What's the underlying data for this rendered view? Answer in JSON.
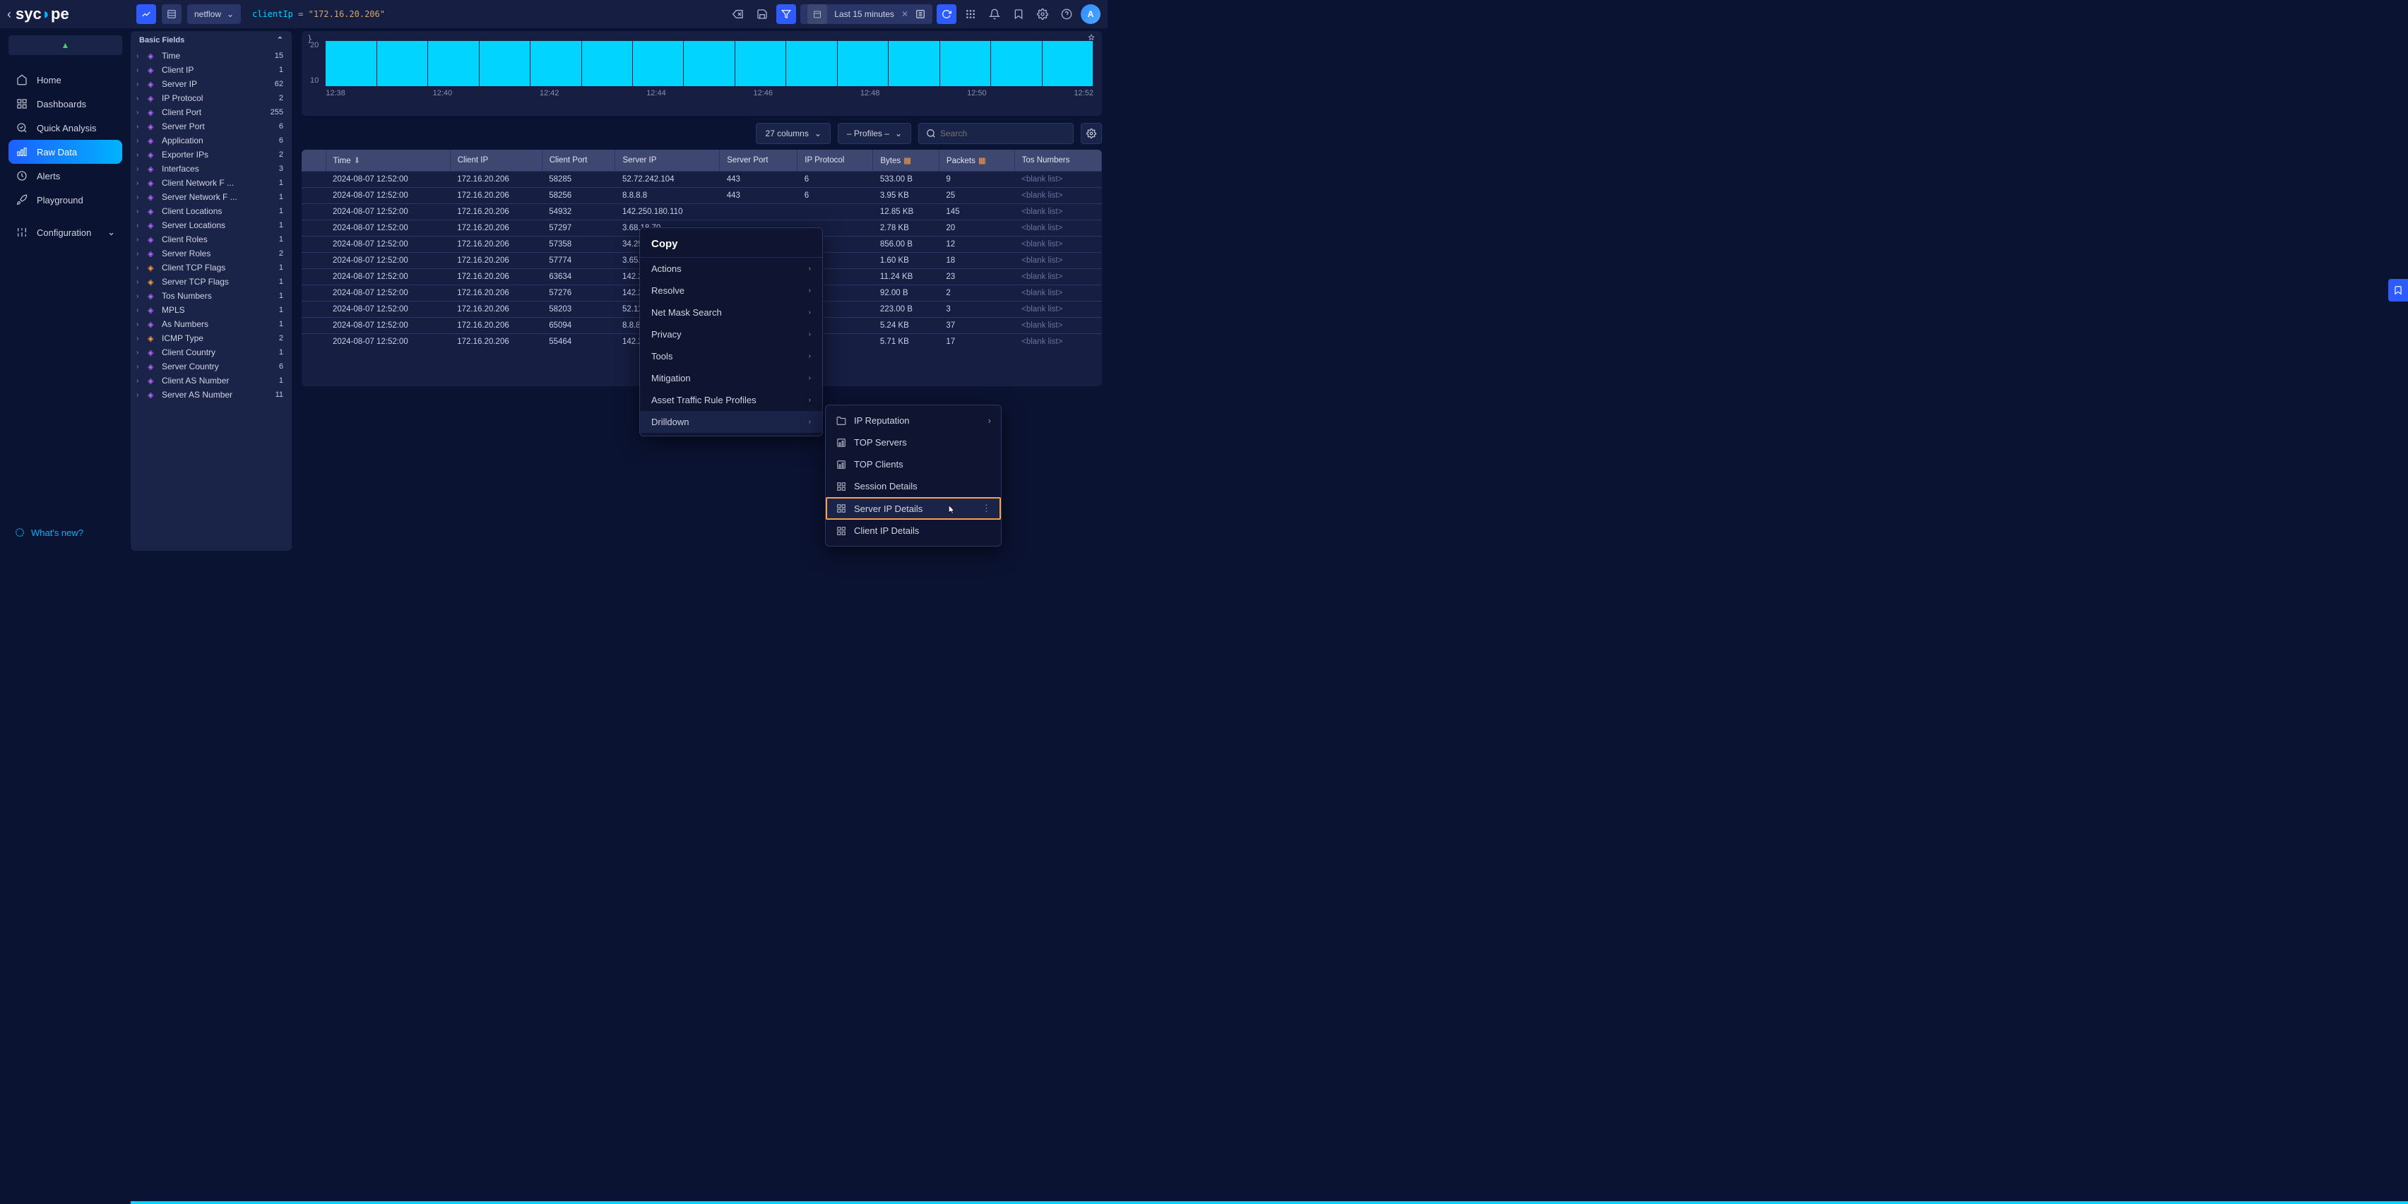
{
  "topbar": {
    "stream": "netflow",
    "query_key": "clientIp",
    "query_eq": "=",
    "query_val": "\"172.16.20.206\"",
    "timerange": "Last 15 minutes",
    "avatar": "A"
  },
  "nav": {
    "items": [
      {
        "label": "Home",
        "icon": "home"
      },
      {
        "label": "Dashboards",
        "icon": "grid"
      },
      {
        "label": "Quick Analysis",
        "icon": "magnify"
      },
      {
        "label": "Raw Data",
        "icon": "bars",
        "active": true
      },
      {
        "label": "Alerts",
        "icon": "bell"
      },
      {
        "label": "Playground",
        "icon": "rocket"
      }
    ],
    "config": "Configuration",
    "whatsnew": "What's new?"
  },
  "fields": {
    "header": "Basic Fields",
    "rows": [
      {
        "name": "Time",
        "count": "15",
        "cube": "p"
      },
      {
        "name": "Client IP",
        "count": "1",
        "cube": "p"
      },
      {
        "name": "Server IP",
        "count": "62",
        "cube": "p"
      },
      {
        "name": "IP Protocol",
        "count": "2",
        "cube": "p"
      },
      {
        "name": "Client Port",
        "count": "255",
        "cube": "p"
      },
      {
        "name": "Server Port",
        "count": "6",
        "cube": "p"
      },
      {
        "name": "Application",
        "count": "6",
        "cube": "p"
      },
      {
        "name": "Exporter IPs",
        "count": "2",
        "cube": "p"
      },
      {
        "name": "Interfaces",
        "count": "3",
        "cube": "p"
      },
      {
        "name": "Client Network F ...",
        "count": "1",
        "cube": "p"
      },
      {
        "name": "Server Network F ...",
        "count": "1",
        "cube": "p"
      },
      {
        "name": "Client Locations",
        "count": "1",
        "cube": "p"
      },
      {
        "name": "Server Locations",
        "count": "1",
        "cube": "p"
      },
      {
        "name": "Client Roles",
        "count": "1",
        "cube": "p"
      },
      {
        "name": "Server Roles",
        "count": "2",
        "cube": "p"
      },
      {
        "name": "Client TCP Flags",
        "count": "1",
        "cube": "o"
      },
      {
        "name": "Server TCP Flags",
        "count": "1",
        "cube": "o"
      },
      {
        "name": "Tos Numbers",
        "count": "1",
        "cube": "p"
      },
      {
        "name": "MPLS",
        "count": "1",
        "cube": "p"
      },
      {
        "name": "As Numbers",
        "count": "1",
        "cube": "p"
      },
      {
        "name": "ICMP Type",
        "count": "2",
        "cube": "o"
      },
      {
        "name": "Client Country",
        "count": "1",
        "cube": "p"
      },
      {
        "name": "Server Country",
        "count": "6",
        "cube": "p"
      },
      {
        "name": "Client AS Number",
        "count": "1",
        "cube": "p"
      },
      {
        "name": "Server AS Number",
        "count": "11",
        "cube": "p"
      }
    ]
  },
  "chart_data": {
    "type": "bar",
    "categories": [
      "12:38",
      "12:40",
      "12:42",
      "12:44",
      "12:46",
      "12:48",
      "12:50",
      "12:52"
    ],
    "values": [
      22,
      22,
      22,
      22,
      22,
      22,
      22,
      22,
      22,
      22,
      22,
      22,
      22,
      22,
      22
    ],
    "ylabel": "",
    "yticks": [
      "20",
      "10"
    ],
    "title": ""
  },
  "table": {
    "controls": {
      "columns": "27 columns",
      "profiles": "– Profiles –",
      "search_ph": "Search"
    },
    "headers": [
      "",
      "Time",
      "Client IP",
      "Client Port",
      "Server IP",
      "Server Port",
      "IP Protocol",
      "Bytes",
      "Packets",
      "Tos Numbers"
    ],
    "rows": [
      [
        "",
        "2024-08-07 12:52:00",
        "172.16.20.206",
        "58285",
        "52.72.242.104",
        "443",
        "6",
        "533.00 B",
        "9",
        "<blank list>"
      ],
      [
        "",
        "2024-08-07 12:52:00",
        "172.16.20.206",
        "58256",
        "8.8.8.8",
        "443",
        "6",
        "3.95 KB",
        "25",
        "<blank list>"
      ],
      [
        "",
        "2024-08-07 12:52:00",
        "172.16.20.206",
        "54932",
        "142.250.180.110",
        "",
        "",
        "12.85 KB",
        "145",
        "<blank list>"
      ],
      [
        "",
        "2024-08-07 12:52:00",
        "172.16.20.206",
        "57297",
        "3.68.18.70",
        "",
        "",
        "2.78 KB",
        "20",
        "<blank list>"
      ],
      [
        "",
        "2024-08-07 12:52:00",
        "172.16.20.206",
        "57358",
        "34.250.115.209",
        "",
        "",
        "856.00 B",
        "12",
        "<blank list>"
      ],
      [
        "",
        "2024-08-07 12:52:00",
        "172.16.20.206",
        "57774",
        "3.65.102.105",
        "",
        "",
        "1.60 KB",
        "18",
        "<blank list>"
      ],
      [
        "",
        "2024-08-07 12:52:00",
        "172.16.20.206",
        "63634",
        "142.250.180.78",
        "",
        "",
        "11.24 KB",
        "23",
        "<blank list>"
      ],
      [
        "",
        "2024-08-07 12:52:00",
        "172.16.20.206",
        "57276",
        "142.250.147.188",
        "",
        "",
        "92.00 B",
        "2",
        "<blank list>"
      ],
      [
        "",
        "2024-08-07 12:52:00",
        "172.16.20.206",
        "58203",
        "52.112.100.2",
        "",
        "",
        "223.00 B",
        "3",
        "<blank list>"
      ],
      [
        "",
        "2024-08-07 12:52:00",
        "172.16.20.206",
        "65094",
        "8.8.8.8",
        "",
        "",
        "5.24 KB",
        "37",
        "<blank list>"
      ],
      [
        "",
        "2024-08-07 12:52:00",
        "172.16.20.206",
        "55464",
        "142.251.143.35",
        "",
        "",
        "5.71 KB",
        "17",
        "<blank list>"
      ]
    ]
  },
  "ctx": {
    "title": "Copy",
    "items": [
      "Actions",
      "Resolve",
      "Net Mask Search",
      "Privacy",
      "Tools",
      "Mitigation",
      "Asset Traffic Rule Profiles",
      "Drilldown"
    ]
  },
  "submenu": {
    "items": [
      {
        "icon": "folder",
        "label": "IP Reputation",
        "more": true
      },
      {
        "icon": "widget",
        "label": "TOP Servers"
      },
      {
        "icon": "widget",
        "label": "TOP Clients"
      },
      {
        "icon": "grid",
        "label": "Session Details"
      },
      {
        "icon": "grid",
        "label": "Server IP Details",
        "highlight": true,
        "dots": true
      },
      {
        "icon": "grid",
        "label": "Client IP Details"
      }
    ]
  }
}
